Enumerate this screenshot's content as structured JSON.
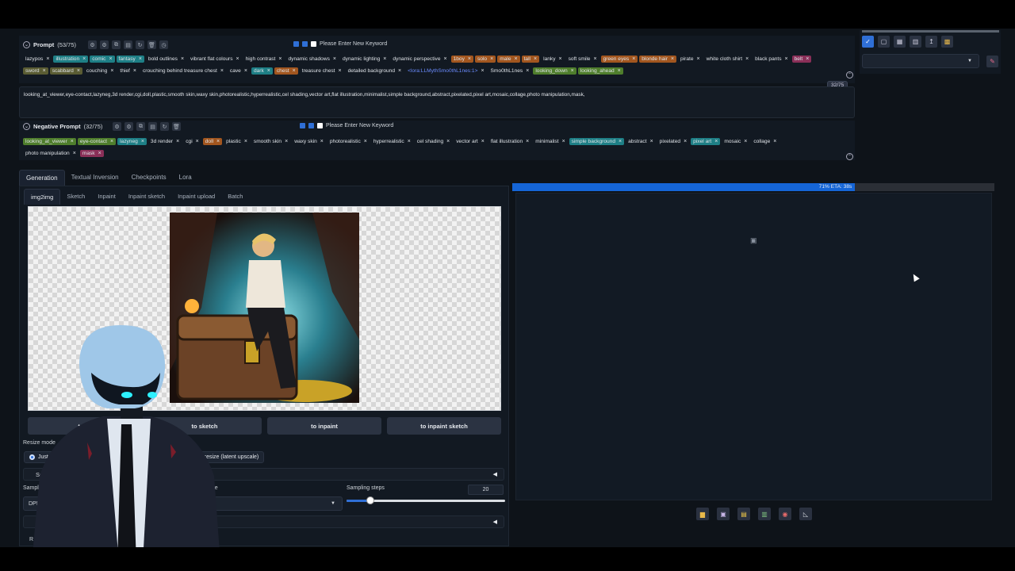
{
  "prompt": {
    "label": "Prompt",
    "count": "(53/75)",
    "keyword_placeholder": "Please Enter New Keyword",
    "tags_row1": [
      {
        "text": "lazypos",
        "style": "plain"
      },
      {
        "text": "illustration",
        "style": "teal"
      },
      {
        "text": "comic",
        "style": "teal"
      },
      {
        "text": "fantasy",
        "style": "teal"
      },
      {
        "text": "bold outlines",
        "style": "plain"
      },
      {
        "text": "vibrant flat colours",
        "style": "plain"
      },
      {
        "text": "high contrast",
        "style": "plain"
      },
      {
        "text": "dynamic shadows",
        "style": "plain"
      },
      {
        "text": "dynamic lighting",
        "style": "plain"
      },
      {
        "text": "dynamic perspective",
        "style": "plain"
      },
      {
        "text": "1boy",
        "style": "orange"
      },
      {
        "text": "solo",
        "style": "orange"
      },
      {
        "text": "male",
        "style": "orange"
      },
      {
        "text": "tall",
        "style": "orange"
      },
      {
        "text": "lanky",
        "style": "plain"
      },
      {
        "text": "soft smile",
        "style": "plain"
      },
      {
        "text": "green eyes",
        "style": "orange"
      },
      {
        "text": "blonde hair",
        "style": "orange"
      },
      {
        "text": "pirate",
        "style": "plain"
      },
      {
        "text": "white cloth shirt",
        "style": "plain"
      },
      {
        "text": "black pants",
        "style": "plain"
      },
      {
        "text": "belt",
        "style": "pink"
      }
    ],
    "tags_row2": [
      {
        "text": "sword",
        "style": "olive"
      },
      {
        "text": "scabbard",
        "style": "olive"
      },
      {
        "text": "couching",
        "style": "plain"
      },
      {
        "text": "thief",
        "style": "plain"
      },
      {
        "text": "crouching behind treasure chest",
        "style": "plain"
      },
      {
        "text": "cave",
        "style": "plain"
      },
      {
        "text": "dark",
        "style": "teal"
      },
      {
        "text": "chest",
        "style": "orange"
      },
      {
        "text": "treasure chest",
        "style": "plain"
      },
      {
        "text": "detailed background",
        "style": "plain"
      },
      {
        "text": "<lora:LLMythSmo0thL1nes:1>",
        "style": "lora"
      },
      {
        "text": "Smo0thL1nes",
        "style": "plain"
      },
      {
        "text": "looking_down",
        "style": "green"
      },
      {
        "text": "looking_ahead",
        "style": "green"
      }
    ]
  },
  "negative_textbox": "looking_at_viewer,eye-contact,lazyneg,3d render,cgi,doll,plastic,smooth skin,waxy skin,photorealistic,hyperrealistic,cel shading,vector art,flat illustration,minimalist,simple background,abstract,pixelated,pixel art,mosaic,collage,photo manipulation,mask,",
  "token_badge": "32/75",
  "negative": {
    "label": "Negative Prompt",
    "count": "(32/75)",
    "keyword_placeholder": "Please Enter New Keyword",
    "tags_row1": [
      {
        "text": "looking_at_viewer",
        "style": "green"
      },
      {
        "text": "eye-contact",
        "style": "green"
      },
      {
        "text": "lazyneg",
        "style": "teal"
      },
      {
        "text": "3d render",
        "style": "plain"
      },
      {
        "text": "cgi",
        "style": "plain"
      },
      {
        "text": "doll",
        "style": "orange"
      },
      {
        "text": "plastic",
        "style": "plain"
      },
      {
        "text": "smooth skin",
        "style": "plain"
      },
      {
        "text": "waxy skin",
        "style": "plain"
      },
      {
        "text": "photorealistic",
        "style": "plain"
      },
      {
        "text": "hyperrealistic",
        "style": "plain"
      },
      {
        "text": "cel shading",
        "style": "plain"
      },
      {
        "text": "vector art",
        "style": "plain"
      },
      {
        "text": "flat illustration",
        "style": "plain"
      },
      {
        "text": "minimalist",
        "style": "plain"
      },
      {
        "text": "simple background",
        "style": "teal"
      },
      {
        "text": "abstract",
        "style": "plain"
      },
      {
        "text": "pixelated",
        "style": "plain"
      },
      {
        "text": "pixel art",
        "style": "teal"
      },
      {
        "text": "mosaic",
        "style": "plain"
      },
      {
        "text": "collage",
        "style": "plain"
      }
    ],
    "tags_row2": [
      {
        "text": "photo manipulation",
        "style": "plain"
      },
      {
        "text": "mask",
        "style": "pink"
      }
    ]
  },
  "main_tabs": [
    "Generation",
    "Textual Inversion",
    "Checkpoints",
    "Lora"
  ],
  "sub_tabs": [
    "img2img",
    "Sketch",
    "Inpaint",
    "Inpaint sketch",
    "Inpaint upload",
    "Batch"
  ],
  "actions": {
    "to_img": "to im",
    "to_sketch": "to sketch",
    "to_inpaint": "to inpaint",
    "to_inpaint_sketch": "to inpaint sketch"
  },
  "resize": {
    "label": "Resize mode",
    "just_resize": "Just res",
    "latent": "Just resize (latent upscale)"
  },
  "soft_inpainting": "Soft I",
  "sampling": {
    "method_label": "Sampling",
    "method_value": "DPM+",
    "schedule_label": "le type",
    "schedule_value": "natic",
    "steps_label": "Sampling steps",
    "steps_value": "20",
    "steps_fraction": 0.15
  },
  "accordion_r": "R",
  "accordion_r2": "R",
  "progress": {
    "text": "71% ETA: 38s",
    "fraction": 0.71
  },
  "colors": {
    "accent": "#2f6fd6",
    "progress": "#1565d6",
    "background": "#0e1319"
  },
  "icons": {
    "output": [
      "folder-icon",
      "save-icon",
      "zip-icon",
      "send-to-img2img-icon",
      "send-to-inpaint-icon",
      "send-to-extras-icon"
    ],
    "rightbar": [
      "checkbox-icon",
      "copy-icon",
      "trash-icon",
      "clipboard-icon",
      "arrow-icon",
      "package-icon"
    ]
  }
}
